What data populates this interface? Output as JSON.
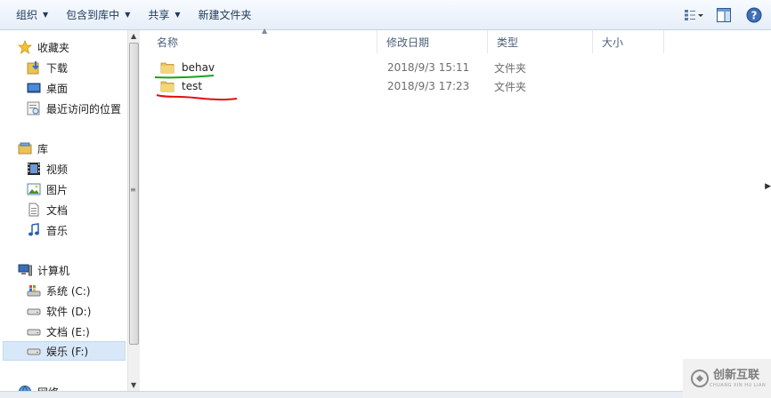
{
  "toolbar": {
    "organize": "组织",
    "include_library": "包含到库中",
    "share": "共享",
    "new_folder": "新建文件夹"
  },
  "nav": {
    "favorites": {
      "label": "收藏夹",
      "items": [
        {
          "label": "下载"
        },
        {
          "label": "桌面"
        },
        {
          "label": "最近访问的位置"
        }
      ]
    },
    "libraries": {
      "label": "库",
      "items": [
        {
          "label": "视频"
        },
        {
          "label": "图片"
        },
        {
          "label": "文档"
        },
        {
          "label": "音乐"
        }
      ]
    },
    "computer": {
      "label": "计算机",
      "items": [
        {
          "label": "系统 (C:)"
        },
        {
          "label": "软件 (D:)"
        },
        {
          "label": "文档 (E:)"
        },
        {
          "label": "娱乐 (F:)"
        }
      ]
    },
    "network": {
      "label": "网络"
    }
  },
  "columns": {
    "name": "名称",
    "modified": "修改日期",
    "type": "类型",
    "size": "大小"
  },
  "files": [
    {
      "name": "behav",
      "modified": "2018/9/3 15:11",
      "type": "文件夹",
      "size": "",
      "underline_color": "#1fa01f"
    },
    {
      "name": "test",
      "modified": "2018/9/3 17:23",
      "type": "文件夹",
      "size": "",
      "underline_color": "#e01010"
    }
  ],
  "watermark": {
    "text": "创新互联",
    "sub": "CHUANG XIN HU LIAN"
  },
  "colors": {
    "toolbar_text": "#1e395b",
    "header_text": "#4c607a",
    "selected_bg": "#d9e8f9",
    "folder": "#e8c35a"
  }
}
